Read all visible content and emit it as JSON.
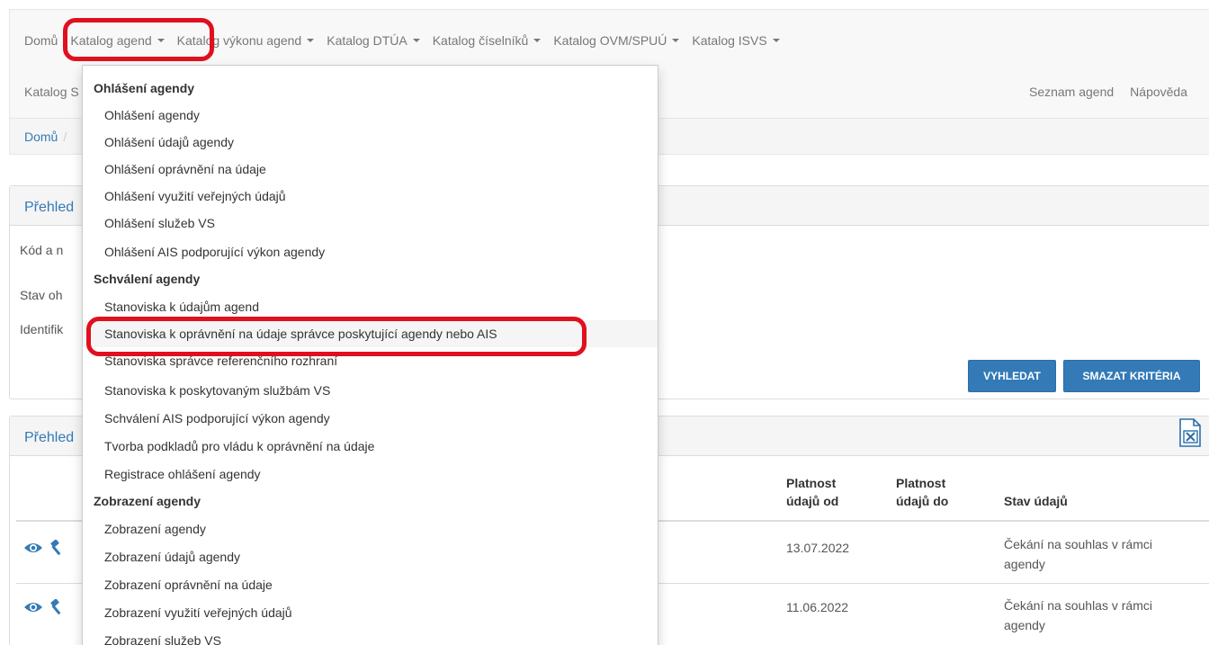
{
  "topnav": {
    "row1": [
      {
        "label": "Domů",
        "caret": false
      },
      {
        "label": "Katalog agend",
        "caret": true
      },
      {
        "label": "Katalog výkonu agend",
        "caret": true
      },
      {
        "label": "Katalog DTÚA",
        "caret": true
      },
      {
        "label": "Katalog číselníků",
        "caret": true
      },
      {
        "label": "Katalog OVM/SPUÚ",
        "caret": true
      },
      {
        "label": "Katalog ISVS",
        "caret": true
      }
    ],
    "row2_partial": "Katalog S",
    "right": {
      "agenda_list": "Seznam agend",
      "help": "Nápověda"
    }
  },
  "breadcrumb": {
    "home": "Domů",
    "separator": "/"
  },
  "search_panel": {
    "title_partial": "Přehled",
    "labels": [
      "Kód a n",
      "Stav oh",
      "Identifik"
    ],
    "search_button": "VYHLEDAT",
    "clear_button": "SMAZAT KRITÉRIA"
  },
  "results_panel": {
    "title_partial": "Přehled",
    "columns": {
      "valid_from_1": "Platnost",
      "valid_from_2": "údajů od",
      "valid_to_1": "Platnost",
      "valid_to_2": "údajů do",
      "status": "Stav údajů"
    },
    "rows": [
      {
        "valid_from": "13.07.2022",
        "valid_to": "",
        "status_1": "Čekání na souhlas v rámci",
        "status_2": "agendy"
      },
      {
        "valid_from": "11.06.2022",
        "valid_to": "",
        "status_1": "Čekání na souhlas v rámci",
        "status_2": "agendy"
      }
    ]
  },
  "dropdown": {
    "sections": [
      {
        "header": "Ohlášení agendy",
        "items": [
          "Ohlášení agendy",
          "Ohlášení údajů agendy",
          "Ohlášení oprávnění na údaje",
          "Ohlášení využití veřejných údajů",
          "Ohlášení služeb VS",
          "Ohlášení AIS podporující výkon agendy"
        ]
      },
      {
        "header": "Schválení agendy",
        "items": [
          "Stanoviska k údajům agend",
          "Stanoviska k oprávnění na údaje správce poskytující agendy nebo AIS",
          "Stanoviska správce referenčního rozhraní",
          "Stanoviska k poskytovaným službám VS",
          "Schválení AIS podporující výkon agendy",
          "Tvorba podkladů pro vládu k oprávnění na údaje",
          "Registrace ohlášení agendy"
        ]
      },
      {
        "header": "Zobrazení agendy",
        "items": [
          "Zobrazení agendy",
          "Zobrazení údajů agendy",
          "Zobrazení oprávnění na údaje",
          "Zobrazení využití veřejných údajů",
          "Zobrazení služeb VS"
        ]
      }
    ]
  },
  "colors": {
    "link": "#337ab7",
    "highlight": "#e0101e",
    "button": "#337ab7"
  },
  "icons": [
    "caret-down-icon",
    "excel-export-icon",
    "eye-icon",
    "gavel-icon"
  ]
}
